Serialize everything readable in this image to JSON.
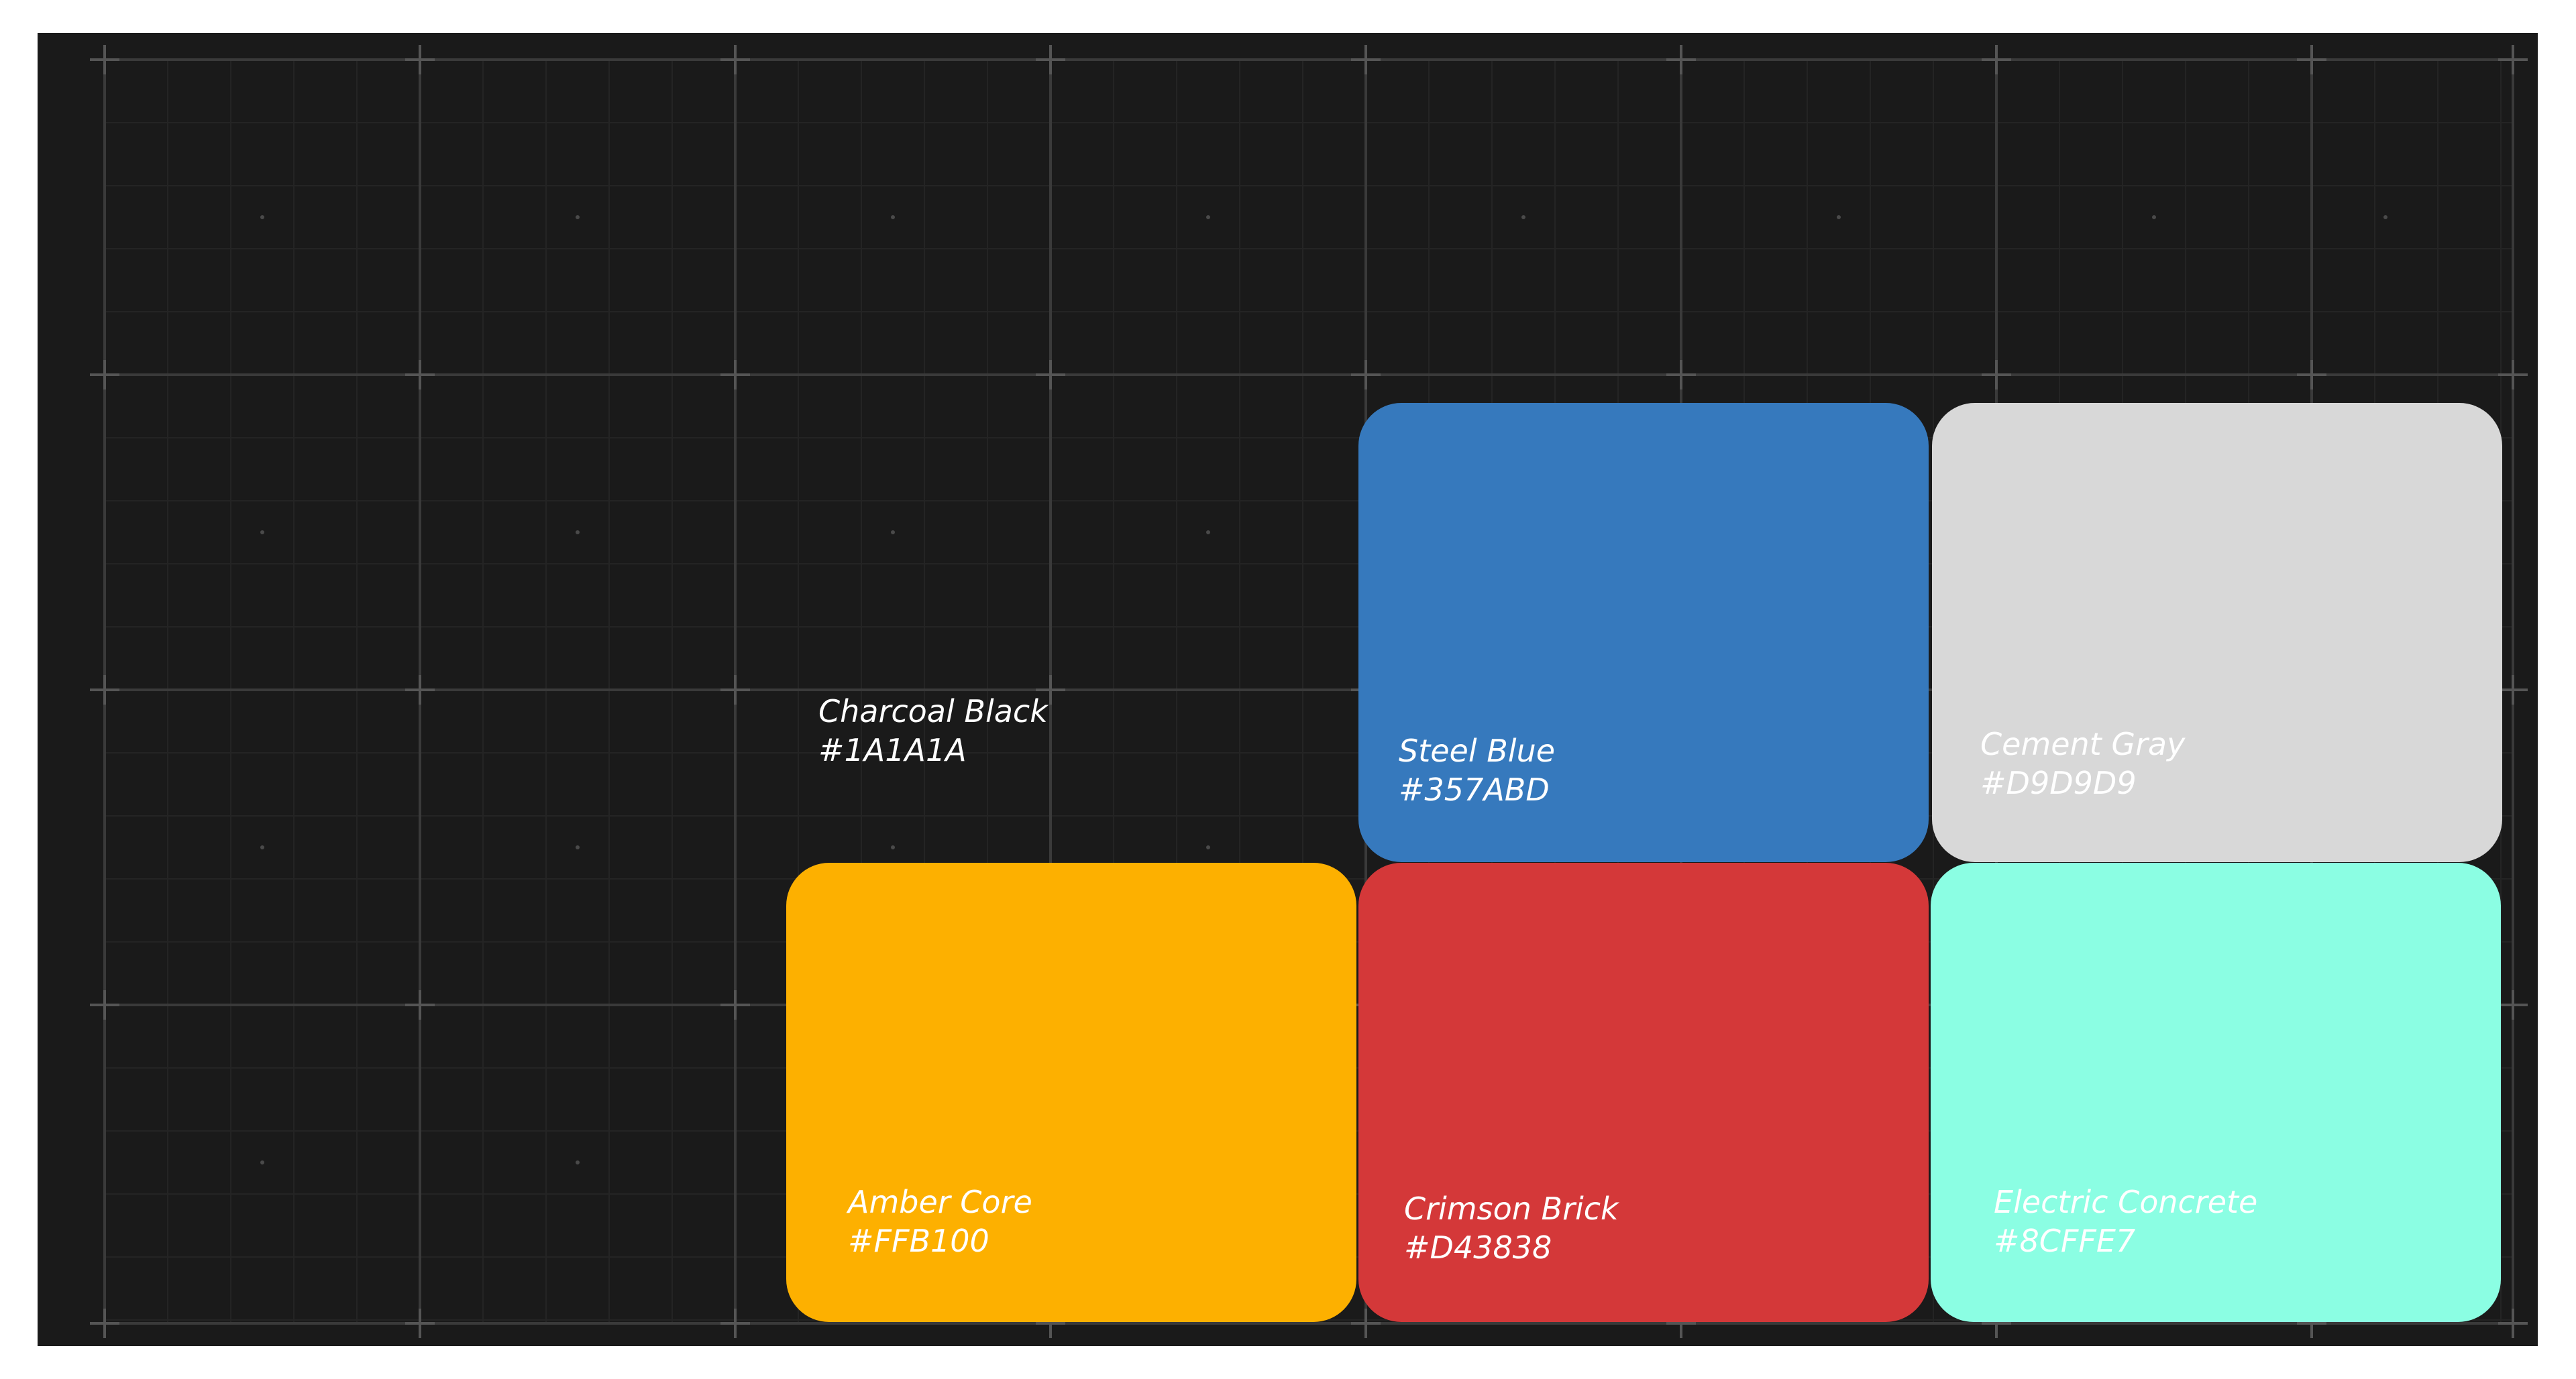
{
  "palette": {
    "background": {
      "name": "Charcoal Black",
      "hex": "#1A1A1A",
      "text_color": "#ffffff"
    },
    "swatches": [
      {
        "name": "Steel Blue",
        "hex": "#357ABD",
        "color": "#3679bd",
        "text_color": "#ffffff"
      },
      {
        "name": "Cement Gray",
        "hex": "#D9D9D9",
        "color": "#d8d8d8",
        "text_color": "#ffffff"
      },
      {
        "name": "Amber Core",
        "hex": "#FFB100",
        "color": "#fdb000",
        "text_color": "#ffffff"
      },
      {
        "name": "Crimson Brick",
        "hex": "#D43838",
        "color": "#d43839",
        "text_color": "#ffffff"
      },
      {
        "name": "Electric Concrete",
        "hex": "#8CFFE7",
        "color": "#8bfee3",
        "text_color": "#ffffff"
      }
    ]
  },
  "grid": {
    "line_color": "#3a3a3a",
    "minor_line_color": "#242424",
    "cross_color": "#555555"
  }
}
